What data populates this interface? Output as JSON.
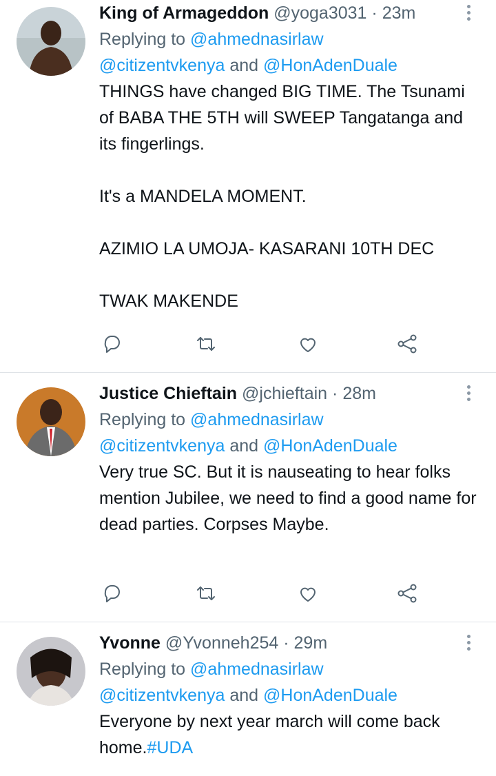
{
  "tweets": [
    {
      "name": "King of Armageddon",
      "handle": "@yoga3031",
      "dot": "·",
      "time": "23m",
      "replying_prefix": "Replying to ",
      "reply_to_1": "@ahmednasirlaw",
      "reply_to_2": "@citizentvkenya",
      "reply_and": " and ",
      "reply_to_3": "@HonAdenDuale",
      "body": "THINGS have changed BIG TIME. The Tsunami of BABA THE 5TH will SWEEP Tangatanga and its fingerlings.\n\nIt's a MANDELA MOMENT.\n\nAZIMIO LA UMOJA- KASARANI 10TH DEC\n\nTWAK MAKENDE"
    },
    {
      "name": "Justice Chieftain",
      "handle": "@jchieftain",
      "dot": "·",
      "time": "28m",
      "replying_prefix": "Replying to ",
      "reply_to_1": "@ahmednasirlaw",
      "reply_to_2": "@citizentvkenya",
      "reply_and": " and ",
      "reply_to_3": "@HonAdenDuale",
      "body": "Very true SC. But it is nauseating to hear folks mention Jubilee, we need to find a good name for dead parties. Corpses Maybe."
    },
    {
      "name": "Yvonne",
      "handle": "@Yvonneh254",
      "dot": "·",
      "time": "29m",
      "replying_prefix": "Replying to ",
      "reply_to_1": "@ahmednasirlaw",
      "reply_to_2": "@citizentvkenya",
      "reply_and": " and ",
      "reply_to_3": "@HonAdenDuale",
      "body": "Everyone by next year march will come back home.",
      "hashtag": "#UDA"
    }
  ],
  "icons": [
    "reply-icon",
    "retweet-icon",
    "like-icon",
    "share-icon",
    "more-icon"
  ],
  "colors": {
    "link": "#1d9bf0",
    "secondary_text": "#536471",
    "text": "#0f1419",
    "divider": "#dfe3e7"
  }
}
